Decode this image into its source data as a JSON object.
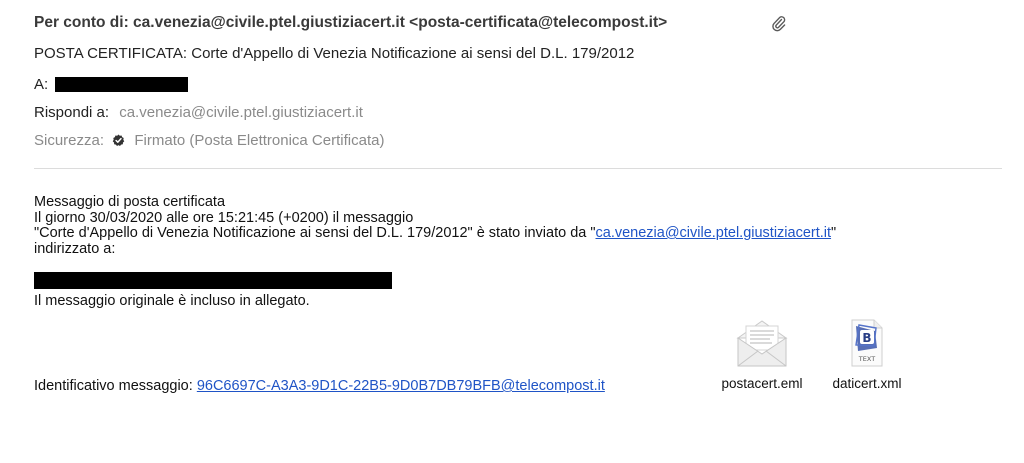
{
  "header": {
    "from_label": "Per conto di:",
    "from_value": "ca.venezia@civile.ptel.giustiziacert.it <posta-certificata@telecompost.it>",
    "subject": "POSTA CERTIFICATA: Corte d'Appello di Venezia Notificazione ai sensi del D.L. 179/2012",
    "to_label": "A:",
    "reply_label": "Rispondi a:",
    "reply_value": "ca.venezia@civile.ptel.giustiziacert.it",
    "security_label": "Sicurezza:",
    "security_value": "Firmato (Posta Elettronica Certificata)",
    "attachment_icon": "paperclip-icon",
    "signed_icon": "verified-badge-icon"
  },
  "body": {
    "line1": "Messaggio di posta certificata",
    "line2": "Il giorno 30/03/2020 alle ore 15:21:45 (+0200) il messaggio",
    "line3_prefix": "\"Corte d'Appello di Venezia Notificazione ai sensi del D.L. 179/2012\" è stato inviato da \"",
    "line3_link": "ca.venezia@civile.ptel.giustiziacert.it",
    "line3_suffix": "\"",
    "line4": "indirizzato a:",
    "original_note": "Il messaggio originale è incluso in allegato."
  },
  "identifier": {
    "label": "Identificativo messaggio:",
    "value": "96C6697C-A3A3-9D1C-22B5-9D0B7DB79BFB@telecompost.it"
  },
  "attachments": [
    {
      "name": "postacert.eml",
      "icon": "email-envelope-icon"
    },
    {
      "name": "daticert.xml",
      "icon": "text-file-icon",
      "icon_caption": "TEXT",
      "icon_letter": "B"
    }
  ],
  "colors": {
    "link": "#1f54c6",
    "muted": "#8a8a8a"
  }
}
